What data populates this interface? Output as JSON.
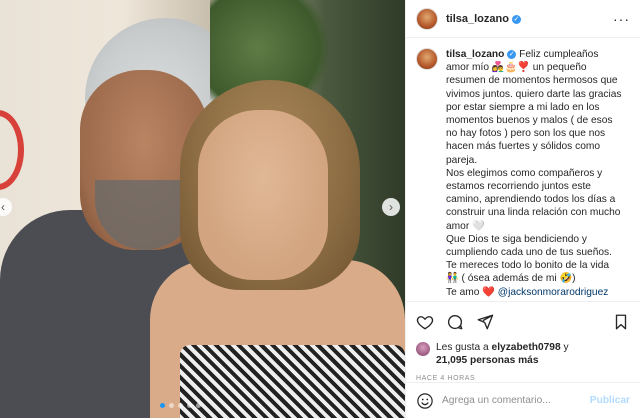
{
  "post": {
    "username": "tilsa_lozano",
    "caption": {
      "text_part_1": "Feliz cumpleaños amor mío 👩‍❤️‍👨🎂❣️ un pequeño resumen de momentos hermosos que vivimos juntos. quiero darte las gracias por estar siempre a mi lado en los momentos buenos y malos ( de esos no hay fotos ) pero son los que nos hacen más fuertes y sólidos como pareja.",
      "text_part_2": "Nos elegimos como compañeros y estamos recorriendo juntos este camino, aprendiendo todos los días a construir una linda relación con mucho amor 🤍",
      "text_part_3": "Que Dios te siga bendiciendo y cumpliendo cada uno de tus sueños. Te mereces todo lo bonito de la vida 👫 ( ósea además de mi 🤣)",
      "text_part_4": "Te amo ❤️",
      "mention": "@jacksonmorarodriguez"
    },
    "likes": {
      "user": "elyzabeth0798",
      "prefix": "Les gusta a",
      "connector": "y",
      "count": "21,095 personas más"
    },
    "timestamp": "HACE 4 HORAS"
  },
  "icons": {
    "more": "more-options-icon",
    "like": "heart-icon",
    "comment": "comment-icon",
    "share": "share-icon",
    "save": "bookmark-icon",
    "emoji": "emoji-icon",
    "verified": "verified-badge-icon",
    "prev": "chevron-left-icon",
    "next": "chevron-right-icon"
  },
  "comment_box": {
    "placeholder": "Agrega un comentario...",
    "publish_label": "Publicar"
  },
  "carousel": {
    "slide_count": 5,
    "active_index": 0,
    "prev_glyph": "‹",
    "next_glyph": "›"
  },
  "colors": {
    "verified": "#3897f0",
    "link": "#00376b",
    "active_dot": "#1c95f0",
    "publish_disabled": "#b3dbff"
  }
}
